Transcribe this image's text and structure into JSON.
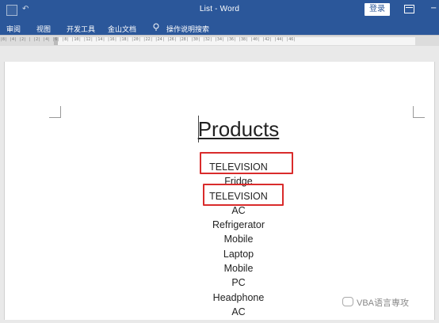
{
  "window": {
    "title": "List - Word",
    "login_label": "登录",
    "minimize_label": "−"
  },
  "ribbon": {
    "tabs": [
      "审阅",
      "视图",
      "开发工具",
      "金山文档"
    ],
    "search_label": "操作说明搜索"
  },
  "ruler": {
    "text": "|8| |4| |2| | |2| |4| |6| |8| |10| |12| |14| |16| |18| |20| |22| |24| |26| |28| |30| |32| |34| |36| |38| |40| |42| |44| |46|"
  },
  "document": {
    "title": "Products",
    "items": [
      "TELEVISION",
      "Fridge",
      "TELEVISION",
      "AC",
      "Refrigerator",
      "Mobile",
      "Laptop",
      "Mobile",
      "PC",
      "Headphone",
      "AC"
    ]
  },
  "watermark": {
    "text": "VBA语言専攻"
  },
  "colors": {
    "accent": "#2b579a",
    "highlight": "#d92b2b"
  },
  "icons": {
    "document": "document-icon",
    "undo": "undo-icon",
    "ribbon_toggle": "ribbon-display-options-icon",
    "search": "lightbulb-search-icon"
  }
}
